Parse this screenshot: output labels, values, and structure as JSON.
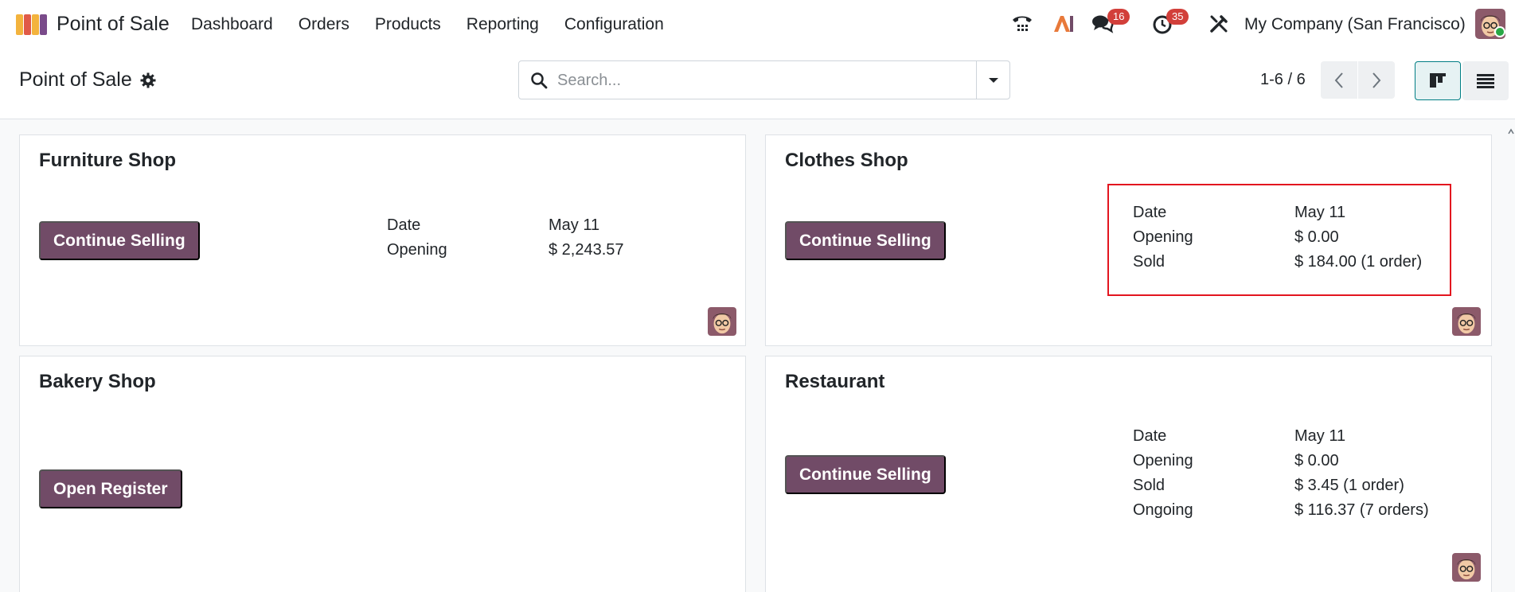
{
  "navbar": {
    "app_name": "Point of Sale",
    "menu": [
      "Dashboard",
      "Orders",
      "Products",
      "Reporting",
      "Configuration"
    ],
    "badges": {
      "messages": "16",
      "activities": "35"
    },
    "company": "My Company (San Francisco)",
    "icons": [
      "phone-icon",
      "ai-icon",
      "messages-icon",
      "activities-icon",
      "tools-icon"
    ]
  },
  "control": {
    "breadcrumb": "Point of Sale",
    "search_placeholder": "Search...",
    "pager": "1-6 / 6"
  },
  "cards": [
    {
      "title": "Furniture Shop",
      "button": "Continue Selling",
      "stats": [
        {
          "label": "Date",
          "value": "May 11"
        },
        {
          "label": "Opening",
          "value": "$ 2,243.57"
        }
      ]
    },
    {
      "title": "Clothes Shop",
      "button": "Continue Selling",
      "stats": [
        {
          "label": "Date",
          "value": "May 11"
        },
        {
          "label": "Opening",
          "value": "$ 0.00"
        },
        {
          "label": "Sold",
          "value": "$ 184.00 (1 order)"
        }
      ]
    },
    {
      "title": "Bakery Shop",
      "button": "Open Register",
      "stats": []
    },
    {
      "title": "Restaurant",
      "button": "Continue Selling",
      "stats": [
        {
          "label": "Date",
          "value": "May 11"
        },
        {
          "label": "Opening",
          "value": "$ 0.00"
        },
        {
          "label": "Sold",
          "value": "$ 3.45 (1 order)"
        },
        {
          "label": "Ongoing",
          "value": "$ 116.37 (7 orders)"
        }
      ]
    }
  ],
  "colors": {
    "brand": "#714b67",
    "highlight": "#e3151f",
    "badge": "#d23f3a",
    "accent": "#017e84"
  }
}
